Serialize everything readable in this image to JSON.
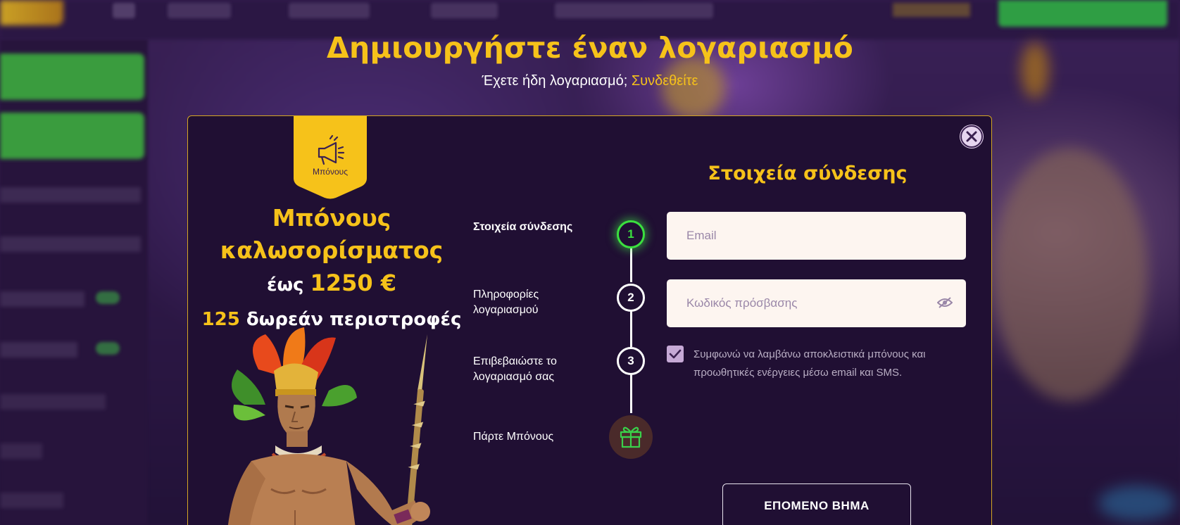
{
  "header": {
    "title": "Δημιουργήστε έναν λογαριασμό",
    "subtitle": "Έχετε ήδη λογαριασμό;",
    "login_link": "Συνδεθείτε"
  },
  "bonus": {
    "tag_label": "Μπόνους",
    "title_line1": "Μπόνους",
    "title_line2": "καλωσορίσματος",
    "amount_prefix": "έως",
    "amount": "1250 €",
    "spins_count": "125",
    "spins_text": "δωρεάν περιστροφές"
  },
  "steps": [
    {
      "number": "1",
      "label": "Στοιχεία σύνδεσης",
      "active": true
    },
    {
      "number": "2",
      "label": "Πληροφορίες λογαριασμού",
      "active": false
    },
    {
      "number": "3",
      "label": "Επιβεβαιώστε το λογαριασμό σας",
      "active": false
    },
    {
      "number": "",
      "label": "Πάρτε Μπόνους",
      "icon": "gift-icon",
      "active": false
    }
  ],
  "form": {
    "title": "Στοιχεία σύνδεσης",
    "email_placeholder": "Email",
    "email_value": "",
    "password_placeholder": "Κωδικός πρόσβασης",
    "password_value": "",
    "consent_text": "Συμφωνώ να λαμβάνω αποκλειστικά μπόνους και προωθητικές ενέργειες μέσω email και SMS.",
    "consent_checked": true,
    "next_button": "ΕΠΟΜΕΝΟ ΒΗΜΑ"
  },
  "colors": {
    "accent_gold": "#f6c21a",
    "active_step_green": "#3be03f",
    "modal_bg": "#200f33"
  },
  "icons": [
    "close-icon",
    "megaphone-icon",
    "eye-off-icon",
    "check-icon",
    "gift-icon"
  ]
}
